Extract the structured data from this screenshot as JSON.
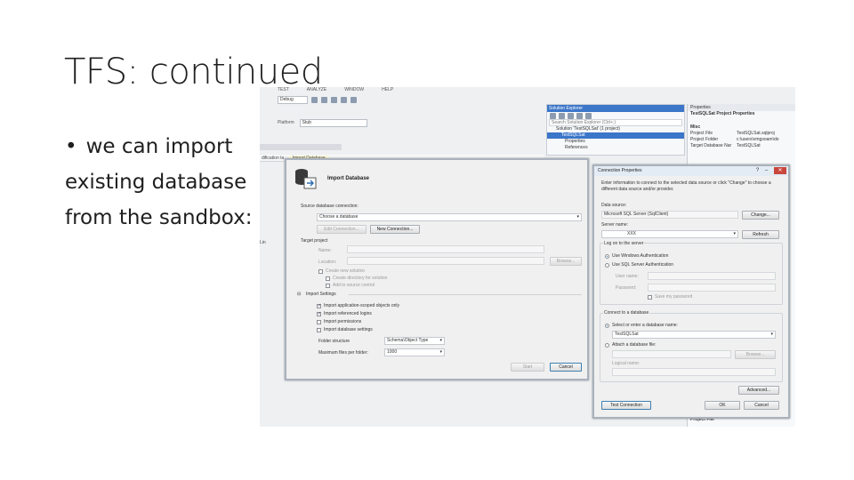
{
  "slide": {
    "title": "TFS: continued",
    "bullet_symbol": "•",
    "bullet_lines": [
      "we can import",
      "existing database",
      "from the sandbox:"
    ]
  },
  "vs": {
    "menu": [
      "TEST",
      "ANALYZE",
      "WINDOW",
      "HELP"
    ],
    "config": "Debug",
    "platform_label": "Platform",
    "platform_value": "Stub",
    "tabs": [
      "dification ta",
      "Import Database"
    ],
    "left_label": "Lin"
  },
  "import_db": {
    "header": "Import Database",
    "source_label": "Source database connection:",
    "source_value": "Choose a database",
    "edit_connection": "Edit Connection...",
    "new_connection": "New Connection...",
    "target_label": "Target project",
    "name_label": "Name:",
    "location_label": "Location:",
    "browse": "Browse...",
    "create_solution": "Create new solution",
    "create_dir": "Create directory for solution",
    "add_source": "Add to source control",
    "import_settings": "Import Settings",
    "options": [
      {
        "label": "Import application-scoped objects only",
        "checked": true
      },
      {
        "label": "Import referenced logins",
        "checked": true
      },
      {
        "label": "Import permissions",
        "checked": false
      },
      {
        "label": "Import database settings",
        "checked": false
      }
    ],
    "folder_label": "Folder structure",
    "folder_value": "Schema\\Object Type",
    "max_files_label": "Maximum files per folder:",
    "max_files_value": "1000",
    "start": "Start",
    "cancel": "Cancel"
  },
  "solution_explorer": {
    "title": "Solution Explorer",
    "search": "Search Solution Explorer (Ctrl+;)",
    "solution": "Solution 'TestSQLSat' (1 project)",
    "project": "TestSQLSat",
    "items": [
      "Properties",
      "References"
    ]
  },
  "properties": {
    "title": "Properties",
    "subject": "TestSQLSat  Project Properties",
    "section": "Misc",
    "rows": [
      {
        "k": "Project File",
        "v": "TestSQLSat.sqlproj"
      },
      {
        "k": "Project Folder",
        "v": "c:\\users\\vmgsoam\\do"
      },
      {
        "k": "Target Database Nar",
        "v": "TestSQLSat"
      }
    ],
    "footer": "Project File"
  },
  "connection": {
    "title": "Connection Properties",
    "intro": "Enter information to connect to the selected data source or click \"Change\" to choose a different data source and/or provider.",
    "ds_label": "Data source:",
    "ds_value": "Microsoft SQL Server (SqlClient)",
    "change": "Change...",
    "server_label": "Server name:",
    "server_value": "XXX",
    "refresh": "Refresh",
    "logon_group": "Log on to the server",
    "windows_auth": "Use Windows Authentication",
    "sql_auth": "Use SQL Server Authentication",
    "user_label": "User name:",
    "pass_label": "Password:",
    "save_password": "Save my password",
    "connect_group": "Connect to a database",
    "select_db": "Select or enter a database name:",
    "db_value": "TestSQLSat",
    "attach": "Attach a database file:",
    "browse": "Browse...",
    "logical_name": "Logical name:",
    "advanced": "Advanced...",
    "test": "Test Connection",
    "ok": "OK",
    "cancel": "Cancel"
  }
}
